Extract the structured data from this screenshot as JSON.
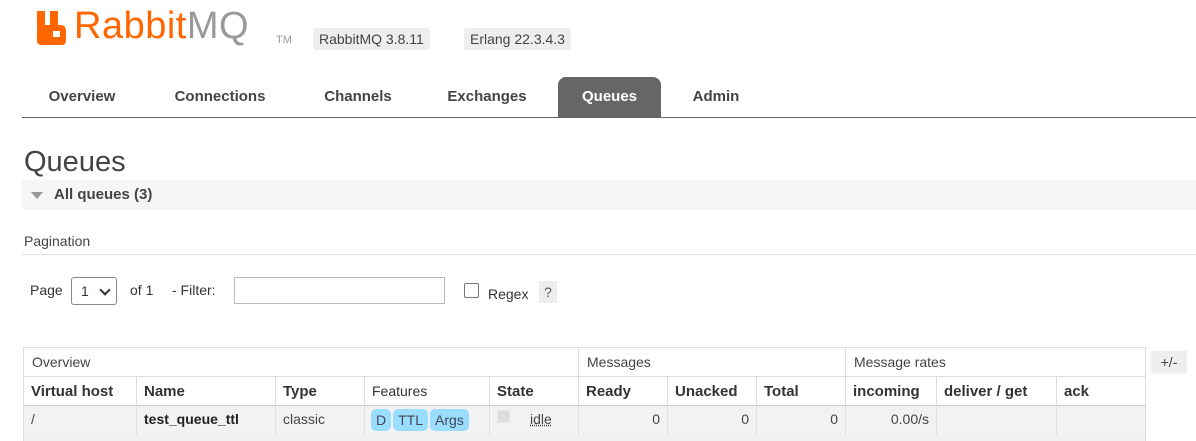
{
  "brand": {
    "name_primary": "Rabbit",
    "name_secondary": "MQ",
    "trademark": "TM",
    "accent_color": "#ff6600",
    "versions": [
      "RabbitMQ 3.8.11",
      "Erlang 22.3.4.3"
    ]
  },
  "nav": {
    "tabs": [
      {
        "label": "Overview",
        "active": false
      },
      {
        "label": "Connections",
        "active": false
      },
      {
        "label": "Channels",
        "active": false
      },
      {
        "label": "Exchanges",
        "active": false
      },
      {
        "label": "Queues",
        "active": true
      },
      {
        "label": "Admin",
        "active": false
      }
    ]
  },
  "page": {
    "title": "Queues",
    "section_label": "All queues (3)",
    "pagination_label": "Pagination"
  },
  "pagination": {
    "page_label": "Page",
    "page_value": "1",
    "of_label": "of 1",
    "filter_label": "- Filter:",
    "filter_value": "",
    "regex_label": "Regex",
    "regex_checked": false,
    "help_label": "?"
  },
  "table": {
    "groups": [
      "Overview",
      "Messages",
      "Message rates"
    ],
    "columns": [
      "Virtual host",
      "Name",
      "Type",
      "Features",
      "State",
      "Ready",
      "Unacked",
      "Total",
      "incoming",
      "deliver / get",
      "ack"
    ],
    "toggle_label": "+/-",
    "rows": [
      {
        "virtual_host": "/",
        "name": "test_queue_ttl",
        "type": "classic",
        "features": [
          "D",
          "TTL",
          "Args"
        ],
        "state": "idle",
        "ready": "0",
        "unacked": "0",
        "total": "0",
        "incoming": "0.00/s",
        "deliver_get": "",
        "ack": ""
      }
    ]
  }
}
